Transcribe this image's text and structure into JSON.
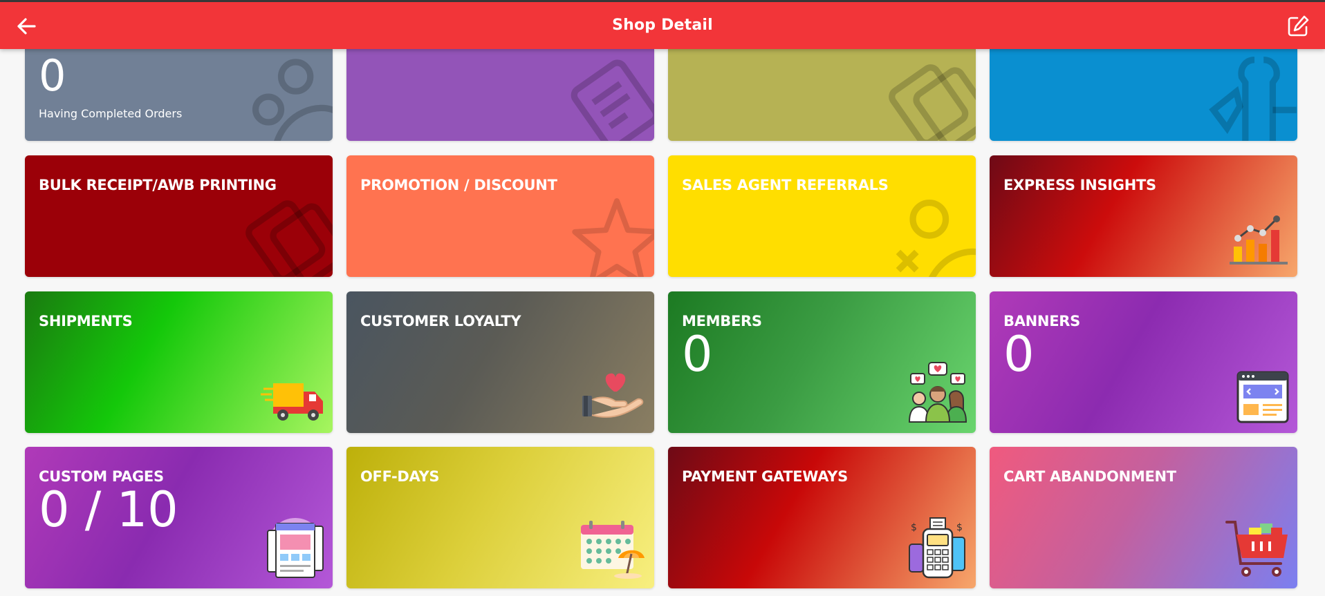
{
  "header": {
    "title": "Shop Detail",
    "back_icon": "arrow-left-icon",
    "edit_icon": "edit-icon",
    "background": "#f23539"
  },
  "row0": {
    "tile1": {
      "value": "0",
      "caption": "Having Completed Orders",
      "icon": "users-icon",
      "color": "#718096"
    },
    "tile2": {
      "icon": "document-icon",
      "color": "#9354b8"
    },
    "tile3": {
      "icon": "copy-icon",
      "color": "#b6b254"
    },
    "tile4": {
      "icon": "tools-icon",
      "color": "#0a8fd0"
    }
  },
  "tiles": [
    {
      "label": "BULK RECEIPT/AWB PRINTING",
      "value": "",
      "icon": "copy-icon",
      "color": "#9b0008"
    },
    {
      "label": "PROMOTION / DISCOUNT",
      "value": "",
      "icon": "star-icon",
      "color": "#ff7350"
    },
    {
      "label": "SALES AGENT REFERRALS",
      "value": "",
      "icon": "user-x-icon",
      "color": "#ffde00"
    },
    {
      "label": "EXPRESS INSIGHTS",
      "value": "",
      "icon": "bar-chart-icon",
      "color": "#cc0c0c"
    },
    {
      "label": "SHIPMENTS",
      "value": "",
      "icon": "delivery-truck-icon",
      "color": "#16c70c"
    },
    {
      "label": "CUSTOMER LOYALTY",
      "value": "",
      "icon": "heart-hand-icon",
      "color": "#5a5a55"
    },
    {
      "label": "MEMBERS",
      "value": "0",
      "icon": "members-group-icon",
      "color": "#3b9c43"
    },
    {
      "label": "BANNERS",
      "value": "0",
      "icon": "browser-banner-icon",
      "color": "#8c2bb0"
    },
    {
      "label": "CUSTOM PAGES",
      "value": "0 / 10",
      "icon": "web-pages-icon",
      "color": "#8a2bb0"
    },
    {
      "label": "OFF-DAYS",
      "value": "",
      "icon": "calendar-beach-icon",
      "color": "#dccf3a"
    },
    {
      "label": "PAYMENT GATEWAYS",
      "value": "",
      "icon": "payment-terminal-icon",
      "color": "#c80808"
    },
    {
      "label": "CART ABANDONMENT",
      "value": "",
      "icon": "shopping-cart-icon",
      "color": "#c4609e"
    }
  ]
}
